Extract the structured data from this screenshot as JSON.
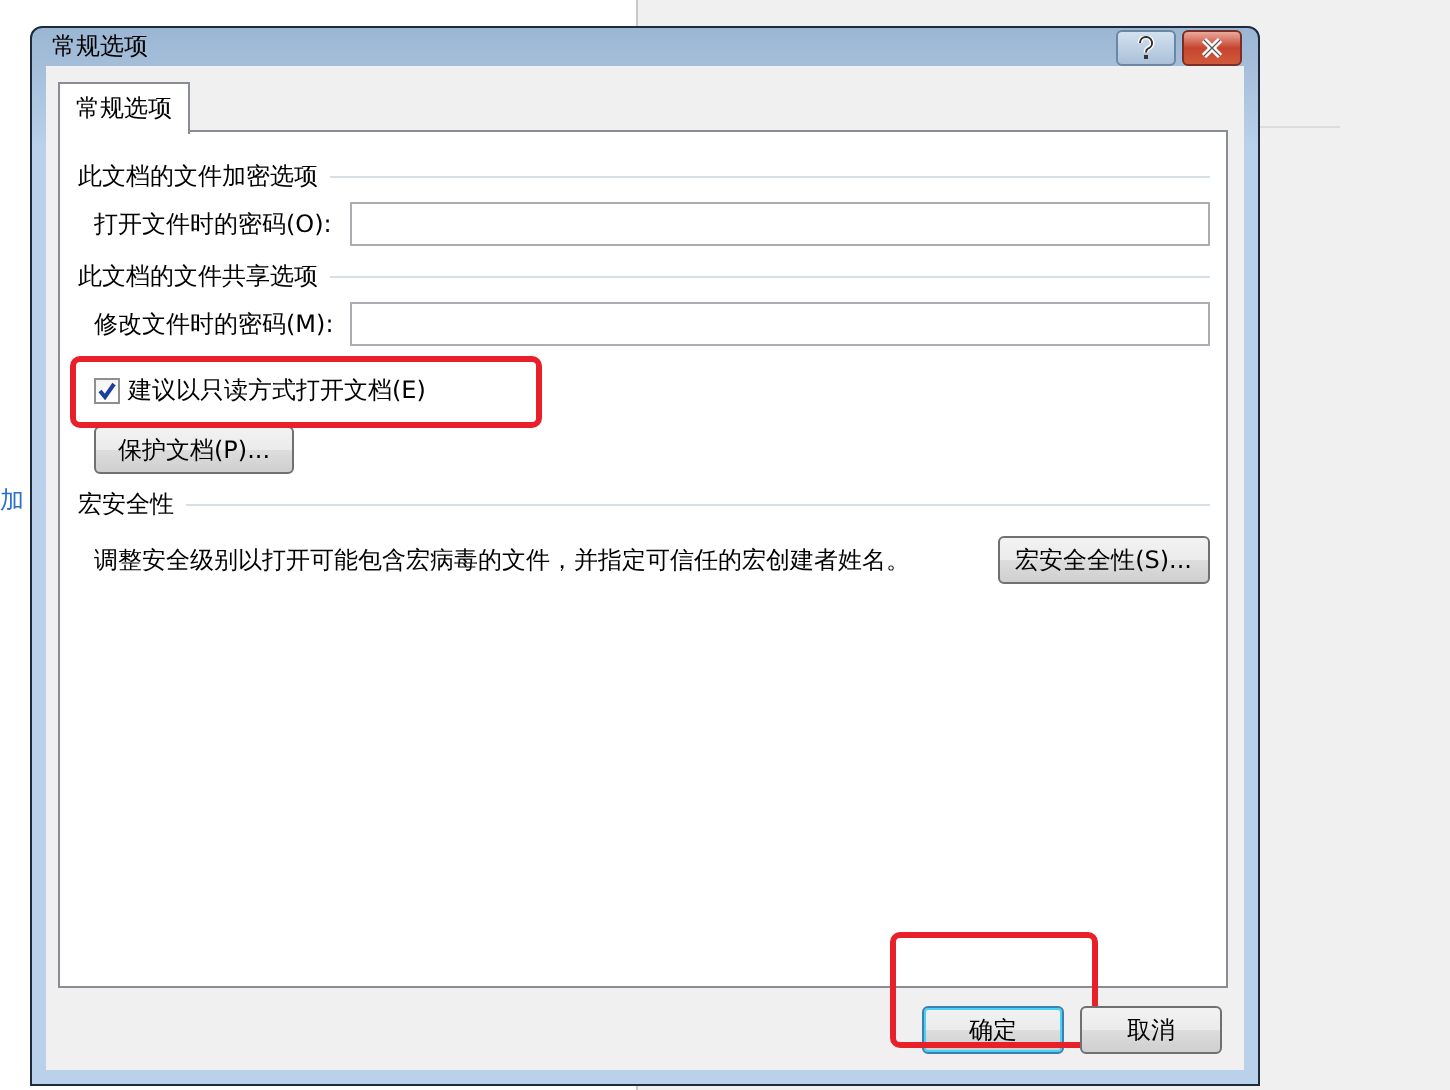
{
  "background": {
    "side_text": "加"
  },
  "dialog": {
    "title": "常规选项"
  },
  "tabs": [
    {
      "label": "常规选项",
      "selected": true
    }
  ],
  "sections": [
    {
      "heading": "此文档的文件加密选项",
      "items": [
        {
          "kind": "password",
          "label": "打开文件时的密码(O):"
        }
      ]
    },
    {
      "heading": "此文档的文件共享选项",
      "items": [
        {
          "kind": "password",
          "label": "修改文件时的密码(M):"
        },
        {
          "kind": "checkbox",
          "label": "建议以只读方式打开文档(E)",
          "checked": true,
          "highlighted": true
        },
        {
          "kind": "button",
          "label": "保护文档(P)..."
        }
      ]
    },
    {
      "heading": "宏安全性",
      "items": [
        {
          "kind": "description",
          "text": "调整安全级别以打开可能包含宏病毒的文件，并指定可信任的宏创建者姓名。",
          "button": "宏安全全性(S)..."
        }
      ]
    }
  ],
  "buttons": [
    {
      "label": "确定",
      "default": true,
      "highlighted": true
    },
    {
      "label": "取消",
      "default": false,
      "highlighted": false
    }
  ]
}
